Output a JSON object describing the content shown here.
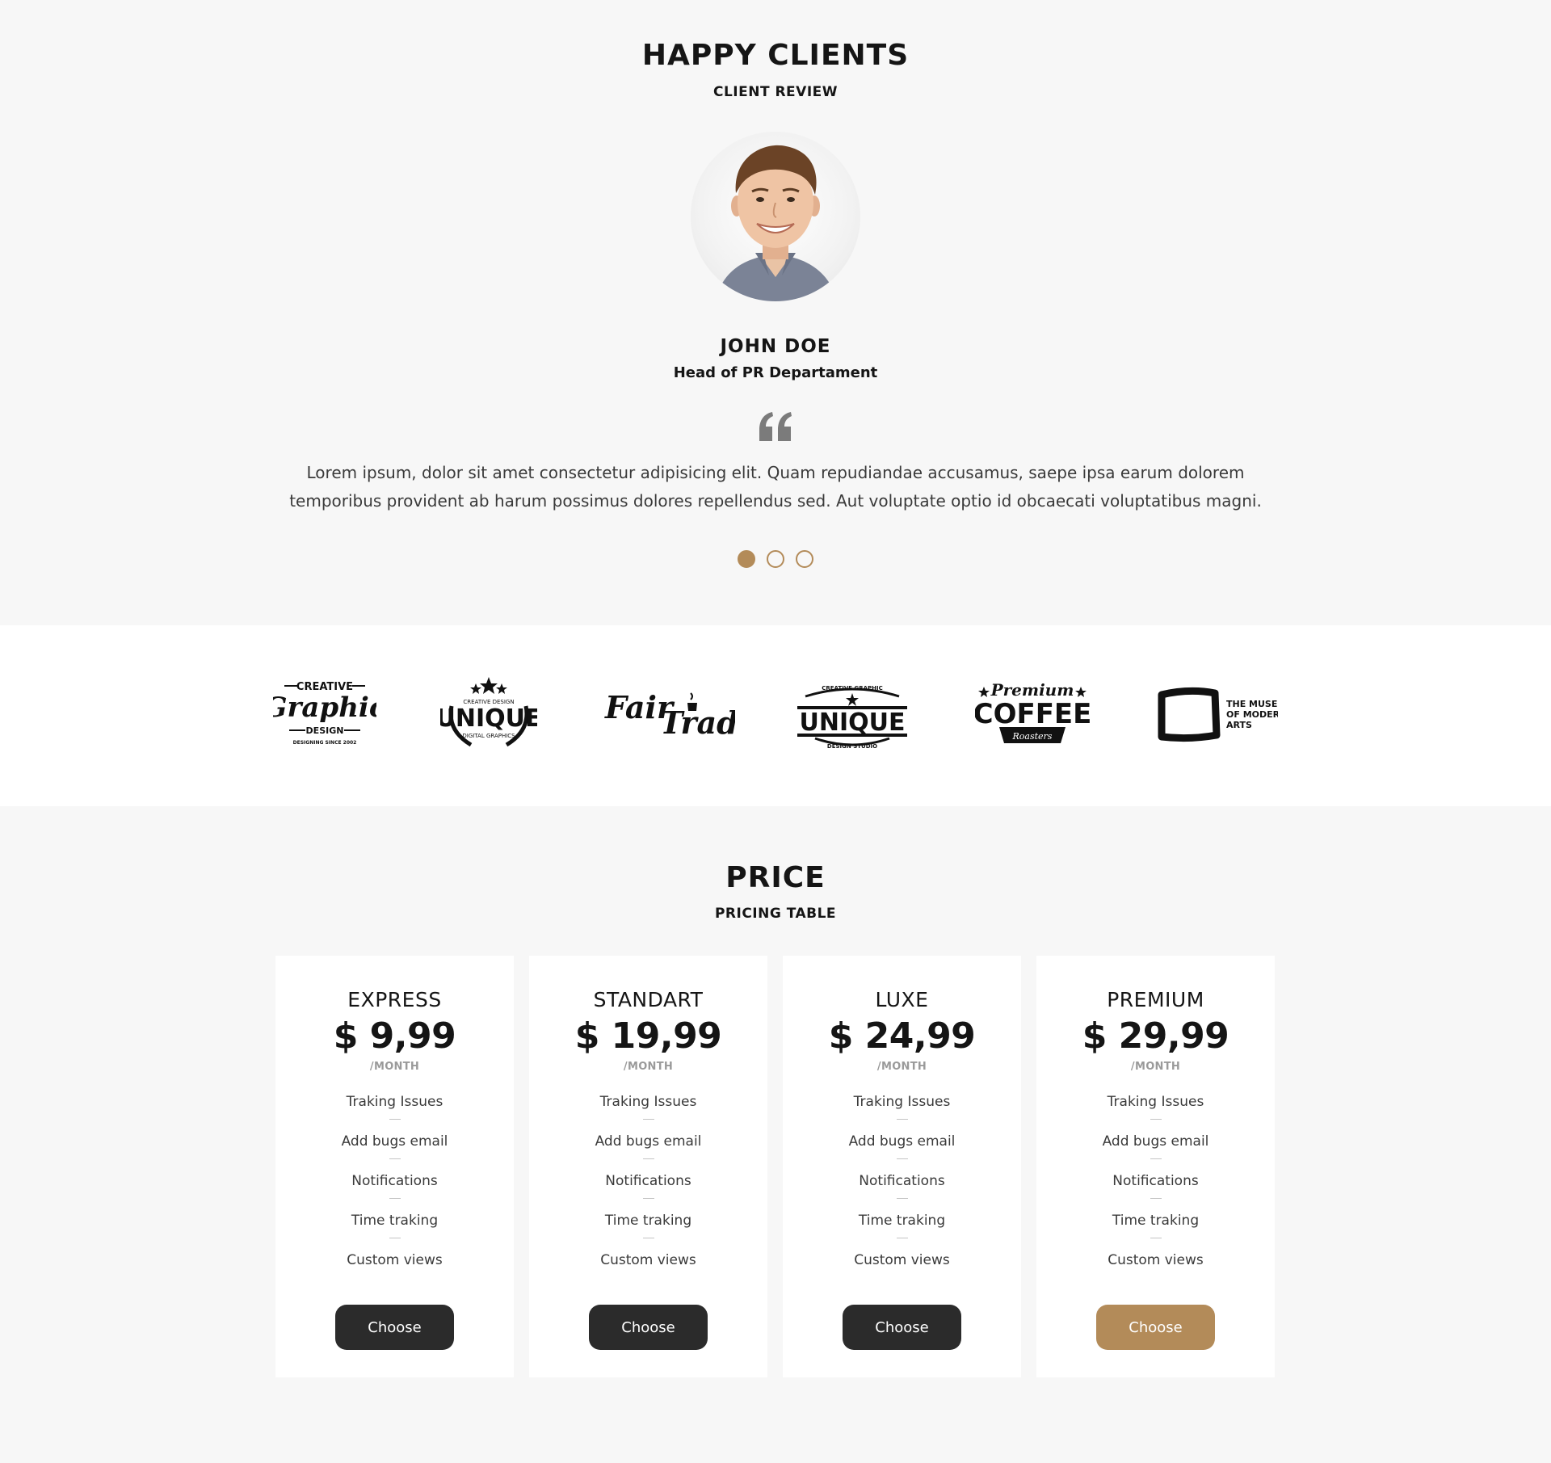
{
  "testimonials": {
    "title": "HAPPY CLIENTS",
    "subtitle": "CLIENT REVIEW",
    "client": {
      "name": "JOHN DOE",
      "role": "Head of PR Departament",
      "review_line1": "Lorem ipsum, dolor sit amet consectetur adipisicing elit. Quam repudiandae accusamus, saepe ipsa earum dolorem",
      "review_line2": "temporibus provident ab harum possimus dolores repellendus sed. Aut voluptate optio id obcaecati voluptatibus magni."
    },
    "slider": {
      "count": 3,
      "active_index": 0
    }
  },
  "brands": [
    {
      "name": "creative-graphic-design-logo",
      "lines": [
        "CREATIVE",
        "Graphic",
        "DESIGN",
        "DESIGNING SINCE 2002"
      ]
    },
    {
      "name": "unique-digital-graphics-logo",
      "lines": [
        "CREATIVE DESIGN",
        "UNIQUE",
        "DIGITAL GRAPHICS"
      ]
    },
    {
      "name": "fair-trade-logo",
      "lines": [
        "Fair",
        "Trade"
      ]
    },
    {
      "name": "unique-design-studio-logo",
      "lines": [
        "CREATIVE GRAPHIC",
        "UNIQUE",
        "DESIGN STUDIO"
      ]
    },
    {
      "name": "premium-coffee-roasters-logo",
      "lines": [
        "Premium",
        "COFFEE",
        "Roasters"
      ]
    },
    {
      "name": "museum-of-modern-arts-logo",
      "lines": [
        "THE MUSEUM",
        "OF MODERN",
        "ARTS"
      ]
    }
  ],
  "pricing": {
    "title": "PRICE",
    "subtitle": "PRICING TABLE",
    "accent_color": "#b38b59",
    "plans": [
      {
        "name": "EXPRESS",
        "price": "$ 9,99",
        "period": "/MONTH",
        "features": [
          "Traking Issues",
          "Add bugs email",
          "Notifications",
          "Time traking",
          "Custom views"
        ],
        "button": "Choose"
      },
      {
        "name": "STANDART",
        "price": "$ 19,99",
        "period": "/MONTH",
        "features": [
          "Traking Issues",
          "Add bugs email",
          "Notifications",
          "Time traking",
          "Custom views"
        ],
        "button": "Choose"
      },
      {
        "name": "LUXE",
        "price": "$ 24,99",
        "period": "/MONTH",
        "features": [
          "Traking Issues",
          "Add bugs email",
          "Notifications",
          "Time traking",
          "Custom views"
        ],
        "button": "Choose"
      },
      {
        "name": "PREMIUM",
        "price": "$ 29,99",
        "period": "/MONTH",
        "features": [
          "Traking Issues",
          "Add bugs email",
          "Notifications",
          "Time traking",
          "Custom views"
        ],
        "button": "Choose"
      }
    ]
  }
}
